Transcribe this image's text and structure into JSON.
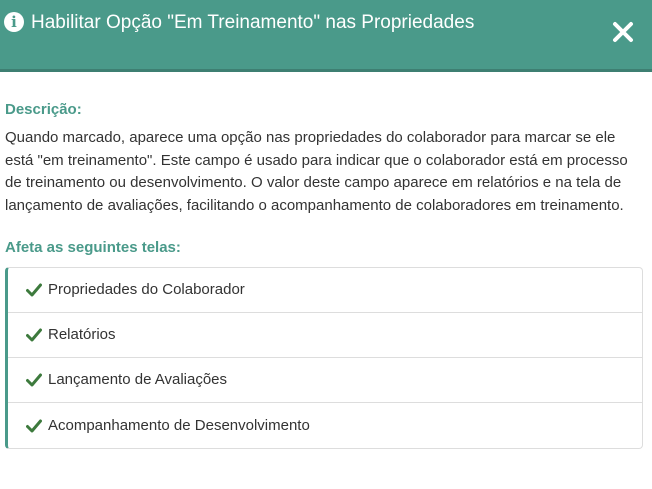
{
  "header": {
    "icon": "info-circle-icon",
    "title": "Habilitar Opção \"Em Treinamento\" nas Propriedades",
    "close_icon": "close-icon"
  },
  "body": {
    "description_label": "Descrição:",
    "description_text": "Quando marcado, aparece uma opção nas propriedades do colaborador para marcar se ele está \"em treinamento\". Este campo é usado para indicar que o colaborador está em processo de treinamento ou desenvolvimento. O valor deste campo aparece em relatórios e na tela de lançamento de avaliações, facilitando o acompanhamento de colaboradores em treinamento.",
    "affects_label": "Afeta as seguintes telas:",
    "screens": [
      {
        "label": "Propriedades do Colaborador",
        "icon": "check-icon"
      },
      {
        "label": "Relatórios",
        "icon": "check-icon"
      },
      {
        "label": "Lançamento de Avaliações",
        "icon": "check-icon"
      },
      {
        "label": "Acompanhamento de Desenvolvimento",
        "icon": "check-icon"
      }
    ]
  },
  "colors": {
    "accent": "#4a9a8a",
    "check": "#3d7a3d",
    "text": "#333333"
  }
}
